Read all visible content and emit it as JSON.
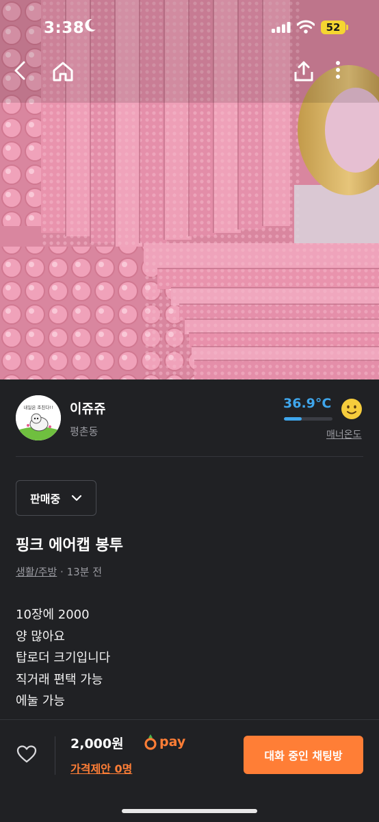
{
  "status_bar": {
    "time": "3:38",
    "battery": "52"
  },
  "nav": {
    "back_icon": "chevron-left-icon",
    "home_icon": "home-icon",
    "share_icon": "share-icon",
    "more_icon": "more-vertical-icon"
  },
  "seller": {
    "name": "이쥬쥬",
    "location": "평촌동",
    "avatar_text": "내일은 조친다!!",
    "temperature": "36.9°C",
    "temperature_level": 0.369,
    "manner_label": "매너온도",
    "temperature_color": "#3fa6ec"
  },
  "listing": {
    "status": "판매중",
    "title": "핑크 에어캡 봉투",
    "category": "생활/주방",
    "time_ago": " · 13분 전",
    "description": [
      "10장에 2000",
      "양 많아요",
      "탑로더 크기입니다",
      "직거래 편택 가능",
      "에눌 가능"
    ]
  },
  "bottom_bar": {
    "price": "2,000원",
    "pay_label": "pay",
    "offer": "가격제안 0명",
    "chat_button": "대화 중인 채팅방",
    "accent": "#ff7e36"
  }
}
